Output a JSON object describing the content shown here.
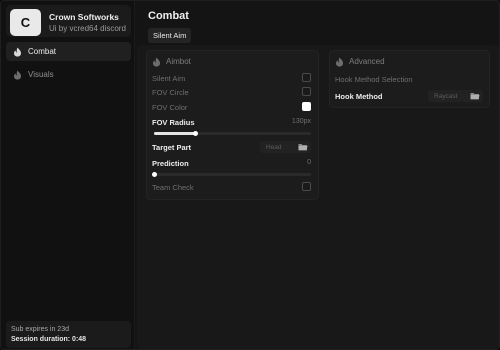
{
  "brand": {
    "logo_letter": "C",
    "name": "Crown Softworks",
    "subtitle": "Ui by vcred64 discord"
  },
  "sidebar": {
    "items": [
      {
        "label": "Combat",
        "icon": "flame-icon",
        "active": true
      },
      {
        "label": "Visuals",
        "icon": "flame-icon",
        "active": false
      }
    ]
  },
  "footer": {
    "expires": "Sub expires in 23d",
    "session": "Session duration: 0:48"
  },
  "main": {
    "title": "Combat",
    "tabs": [
      {
        "label": "Silent Aim",
        "active": true
      }
    ]
  },
  "aimbot": {
    "header": "Aimbot",
    "silent_aim": {
      "label": "Silent Aim",
      "checked": false
    },
    "fov_circle": {
      "label": "FOV Circle",
      "checked": false
    },
    "fov_color": {
      "label": "FOV Color",
      "color": "#ffffff"
    },
    "fov_radius": {
      "label": "FOV Radius",
      "value_text": "130px",
      "value": 130,
      "fraction": 0.26
    },
    "target_part": {
      "label": "Target Part",
      "selected": "Head"
    },
    "prediction": {
      "label": "Prediction",
      "value_text": "0",
      "value": 0,
      "fraction": 0.0
    },
    "team_check": {
      "label": "Team Check",
      "checked": false
    }
  },
  "advanced": {
    "header": "Advanced",
    "section_label": "Hook Method Selection",
    "hook_method": {
      "label": "Hook Method",
      "selected": "Raycast"
    }
  },
  "colors": {
    "accent": "#ffffff",
    "background": "#141414",
    "panel": "#1c1c1c"
  }
}
